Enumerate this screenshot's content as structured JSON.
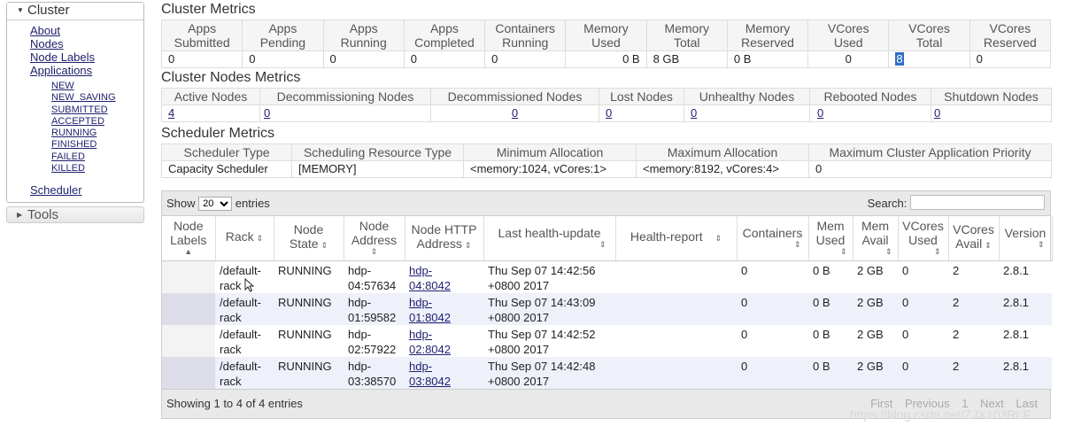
{
  "sidebar": {
    "cluster_title": "Cluster",
    "links": [
      "About",
      "Nodes",
      "Node Labels",
      "Applications"
    ],
    "app_states": [
      "NEW",
      "NEW_SAVING",
      "SUBMITTED",
      "ACCEPTED",
      "RUNNING",
      "FINISHED",
      "FAILED",
      "KILLED"
    ],
    "scheduler": "Scheduler",
    "tools_title": "Tools"
  },
  "cluster_metrics": {
    "title": "Cluster Metrics",
    "headers": [
      [
        "Apps",
        "Submitted"
      ],
      [
        "Apps",
        "Pending"
      ],
      [
        "Apps",
        "Running"
      ],
      [
        "Apps",
        "Completed"
      ],
      [
        "Containers",
        "Running"
      ],
      [
        "Memory",
        "Used"
      ],
      [
        "Memory",
        "Total"
      ],
      [
        "Memory",
        "Reserved"
      ],
      [
        "VCores",
        "Used"
      ],
      [
        "VCores",
        "Total"
      ],
      [
        "VCores",
        "Reserved"
      ]
    ],
    "values": [
      "0",
      "0",
      "0",
      "0",
      "0",
      "0 B",
      "8 GB",
      "0 B",
      "0",
      "8",
      "0"
    ]
  },
  "nodes_metrics": {
    "title": "Cluster Nodes Metrics",
    "headers": [
      "Active Nodes",
      "Decommissioning Nodes",
      "Decommissioned Nodes",
      "Lost Nodes",
      "Unhealthy Nodes",
      "Rebooted Nodes",
      "Shutdown Nodes"
    ],
    "values": [
      "4",
      "0",
      "0",
      "0",
      "0",
      "0",
      "0"
    ]
  },
  "scheduler_metrics": {
    "title": "Scheduler Metrics",
    "headers": [
      "Scheduler Type",
      "Scheduling Resource Type",
      "Minimum Allocation",
      "Maximum Allocation",
      "Maximum Cluster Application Priority"
    ],
    "values": [
      "Capacity Scheduler",
      "[MEMORY]",
      "<memory:1024, vCores:1>",
      "<memory:8192, vCores:4>",
      "0"
    ]
  },
  "nodes_table": {
    "show_label": "Show",
    "entries_label": "entries",
    "page_size": "20",
    "search_label": "Search:",
    "headers": [
      [
        "Node",
        "Labels"
      ],
      [
        "Rack"
      ],
      [
        "Node",
        "State"
      ],
      [
        "Node",
        "Address"
      ],
      [
        "Node HTTP",
        "Address"
      ],
      [
        "Last health-update"
      ],
      [
        "Health-report"
      ],
      [
        "Containers"
      ],
      [
        "Mem",
        "Used"
      ],
      [
        "Mem",
        "Avail"
      ],
      [
        "VCores",
        "Used"
      ],
      [
        "VCores",
        "Avail"
      ],
      [
        "Version"
      ]
    ],
    "rows": [
      {
        "labels": "",
        "rack": [
          "/default-",
          "rack"
        ],
        "state": "RUNNING",
        "address": [
          "hdp-",
          "04:57634"
        ],
        "http": [
          "hdp-",
          "04:8042"
        ],
        "health_update": [
          "Thu Sep 07 14:42:56",
          "+0800 2017"
        ],
        "health_report": "",
        "containers": "0",
        "mem_used": "0 B",
        "mem_avail": "2 GB",
        "vcores_used": "0",
        "vcores_avail": "2",
        "version": "2.8.1"
      },
      {
        "labels": "",
        "rack": [
          "/default-",
          "rack"
        ],
        "state": "RUNNING",
        "address": [
          "hdp-",
          "01:59582"
        ],
        "http": [
          "hdp-",
          "01:8042"
        ],
        "health_update": [
          "Thu Sep 07 14:43:09",
          "+0800 2017"
        ],
        "health_report": "",
        "containers": "0",
        "mem_used": "0 B",
        "mem_avail": "2 GB",
        "vcores_used": "0",
        "vcores_avail": "2",
        "version": "2.8.1"
      },
      {
        "labels": "",
        "rack": [
          "/default-",
          "rack"
        ],
        "state": "RUNNING",
        "address": [
          "hdp-",
          "02:57922"
        ],
        "http": [
          "hdp-",
          "02:8042"
        ],
        "health_update": [
          "Thu Sep 07 14:42:52",
          "+0800 2017"
        ],
        "health_report": "",
        "containers": "0",
        "mem_used": "0 B",
        "mem_avail": "2 GB",
        "vcores_used": "0",
        "vcores_avail": "2",
        "version": "2.8.1"
      },
      {
        "labels": "",
        "rack": [
          "/default-",
          "rack"
        ],
        "state": "RUNNING",
        "address": [
          "hdp-",
          "03:38570"
        ],
        "http": [
          "hdp-",
          "03:8042"
        ],
        "health_update": [
          "Thu Sep 07 14:42:48",
          "+0800 2017"
        ],
        "health_report": "",
        "containers": "0",
        "mem_used": "0 B",
        "mem_avail": "2 GB",
        "vcores_used": "0",
        "vcores_avail": "2",
        "version": "2.8.1"
      }
    ],
    "info": "Showing 1 to 4 of 4 entries",
    "pager": {
      "first": "First",
      "previous": "Previous",
      "page": "1",
      "next": "Next",
      "last": "Last"
    }
  },
  "watermark": "https://blog.csdn.net/ZJX103RLF",
  "colors": {
    "highlight": "#2f6fc6",
    "even_row": "#eef0fa",
    "link": "#1f1f6e"
  }
}
